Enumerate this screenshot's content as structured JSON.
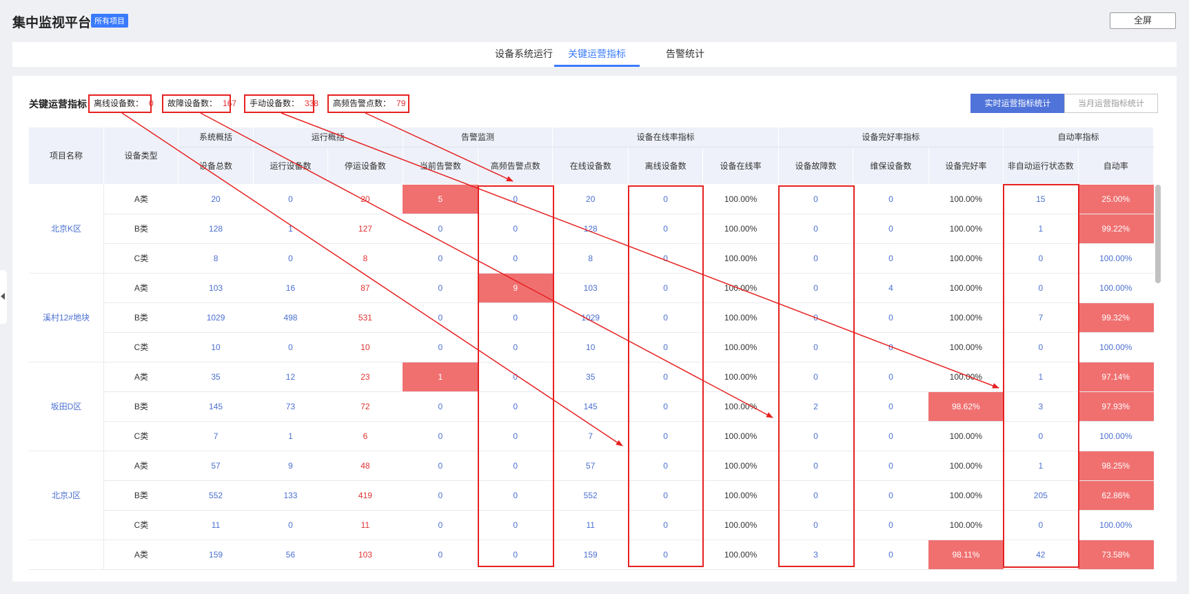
{
  "header": {
    "title": "集中监视平台",
    "badge": "所有项目",
    "fullscreen_label": "全屏"
  },
  "tabs": [
    {
      "label": "设备系统运行",
      "active": false
    },
    {
      "label": "关键运营指标",
      "active": true
    },
    {
      "label": "告警统计",
      "active": false
    }
  ],
  "section": {
    "title": "关键运营指标",
    "stats": [
      {
        "label": "离线设备数：",
        "value": "0"
      },
      {
        "label": "故障设备数：",
        "value": "167"
      },
      {
        "label": "手动设备数：",
        "value": "338"
      },
      {
        "label": "高频告警点数：",
        "value": "79"
      }
    ],
    "buttons": [
      {
        "label": "实时运营指标统计",
        "active": true
      },
      {
        "label": "当月运营指标统计",
        "active": false
      }
    ]
  },
  "table": {
    "col_project": "项目名称",
    "col_type": "设备类型",
    "groups": [
      "系统概括",
      "运行概括",
      "告警监测",
      "设备在线率指标",
      "设备完好率指标",
      "自动率指标"
    ],
    "columns": [
      "设备总数",
      "运行设备数",
      "停运设备数",
      "当前告警数",
      "高频告警点数",
      "在线设备数",
      "离线设备数",
      "设备在线率",
      "设备故障数",
      "维保设备数",
      "设备完好率",
      "非自动运行状态数",
      "自动率"
    ],
    "projects": [
      {
        "name": "北京K区",
        "rows": [
          {
            "type": "A类",
            "cells": [
              "20",
              "0",
              "20",
              "5",
              "0",
              "20",
              "0",
              "100.00%",
              "0",
              "0",
              "100.00%",
              "15",
              "25.00%"
            ]
          },
          {
            "type": "B类",
            "cells": [
              "128",
              "1",
              "127",
              "0",
              "0",
              "128",
              "0",
              "100.00%",
              "0",
              "0",
              "100.00%",
              "1",
              "99.22%"
            ]
          },
          {
            "type": "C类",
            "cells": [
              "8",
              "0",
              "8",
              "0",
              "0",
              "8",
              "0",
              "100.00%",
              "0",
              "0",
              "100.00%",
              "0",
              "100.00%"
            ]
          }
        ]
      },
      {
        "name": "溪村12#地块",
        "rows": [
          {
            "type": "A类",
            "cells": [
              "103",
              "16",
              "87",
              "0",
              "9",
              "103",
              "0",
              "100.00%",
              "0",
              "4",
              "100.00%",
              "0",
              "100.00%"
            ]
          },
          {
            "type": "B类",
            "cells": [
              "1029",
              "498",
              "531",
              "0",
              "0",
              "1029",
              "0",
              "100.00%",
              "0",
              "0",
              "100.00%",
              "7",
              "99.32%"
            ]
          },
          {
            "type": "C类",
            "cells": [
              "10",
              "0",
              "10",
              "0",
              "0",
              "10",
              "0",
              "100.00%",
              "0",
              "0",
              "100.00%",
              "0",
              "100.00%"
            ]
          }
        ]
      },
      {
        "name": "坂田D区",
        "rows": [
          {
            "type": "A类",
            "cells": [
              "35",
              "12",
              "23",
              "1",
              "0",
              "35",
              "0",
              "100.00%",
              "0",
              "0",
              "100.00%",
              "1",
              "97.14%"
            ]
          },
          {
            "type": "B类",
            "cells": [
              "145",
              "73",
              "72",
              "0",
              "0",
              "145",
              "0",
              "100.00%",
              "2",
              "0",
              "98.62%",
              "3",
              "97.93%"
            ]
          },
          {
            "type": "C类",
            "cells": [
              "7",
              "1",
              "6",
              "0",
              "0",
              "7",
              "0",
              "100.00%",
              "0",
              "0",
              "100.00%",
              "0",
              "100.00%"
            ]
          }
        ]
      },
      {
        "name": "北京J区",
        "rows": [
          {
            "type": "A类",
            "cells": [
              "57",
              "9",
              "48",
              "0",
              "0",
              "57",
              "0",
              "100.00%",
              "0",
              "0",
              "100.00%",
              "1",
              "98.25%"
            ]
          },
          {
            "type": "B类",
            "cells": [
              "552",
              "133",
              "419",
              "0",
              "0",
              "552",
              "0",
              "100.00%",
              "0",
              "0",
              "100.00%",
              "205",
              "62.86%"
            ]
          },
          {
            "type": "C类",
            "cells": [
              "11",
              "0",
              "11",
              "0",
              "0",
              "11",
              "0",
              "100.00%",
              "0",
              "0",
              "100.00%",
              "0",
              "100.00%"
            ]
          }
        ]
      },
      {
        "name": "",
        "rows": [
          {
            "type": "A类",
            "cells": [
              "159",
              "56",
              "103",
              "0",
              "0",
              "159",
              "0",
              "100.00%",
              "3",
              "0",
              "98.11%",
              "42",
              "73.58%"
            ]
          }
        ]
      }
    ]
  },
  "colors": {
    "accent": "#3a7bfd",
    "button_active": "#4f73d9",
    "highlight_cell": "#f07070",
    "value_blue": "#4a6fd0",
    "value_red": "#e03030",
    "annotation_red": "#e62020"
  }
}
